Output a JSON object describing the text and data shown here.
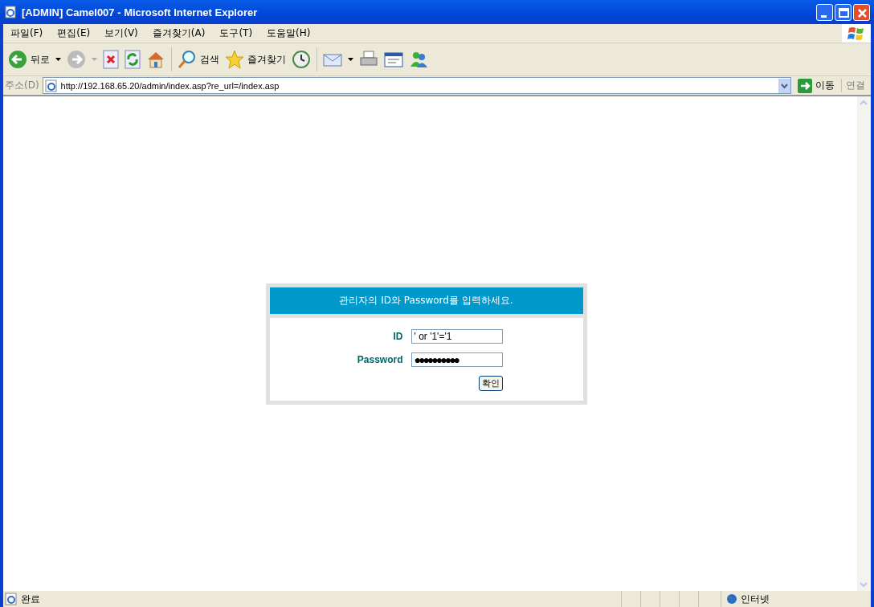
{
  "window": {
    "title": "[ADMIN] Camel007 - Microsoft Internet Explorer"
  },
  "menu": [
    {
      "label": "파일(F)"
    },
    {
      "label": "편집(E)"
    },
    {
      "label": "보기(V)"
    },
    {
      "label": "즐겨찾기(A)"
    },
    {
      "label": "도구(T)"
    },
    {
      "label": "도움말(H)"
    }
  ],
  "toolbar": {
    "back": "뒤로",
    "search": "검색",
    "favorites": "즐겨찾기"
  },
  "address": {
    "label": "주소(D)",
    "value": "http://192.168.65.20/admin/index.asp?re_url=/index.asp",
    "go": "이동",
    "links": "연결"
  },
  "login": {
    "heading": "관리자의 ID와 Password를 입력하세요.",
    "id_label": "ID",
    "id_value": "' or '1'='1",
    "password_label": "Password",
    "password_value": "●●●●●●●●●●",
    "submit": "확인"
  },
  "status_bar": {
    "text": "완료",
    "zone": "인터넷"
  }
}
